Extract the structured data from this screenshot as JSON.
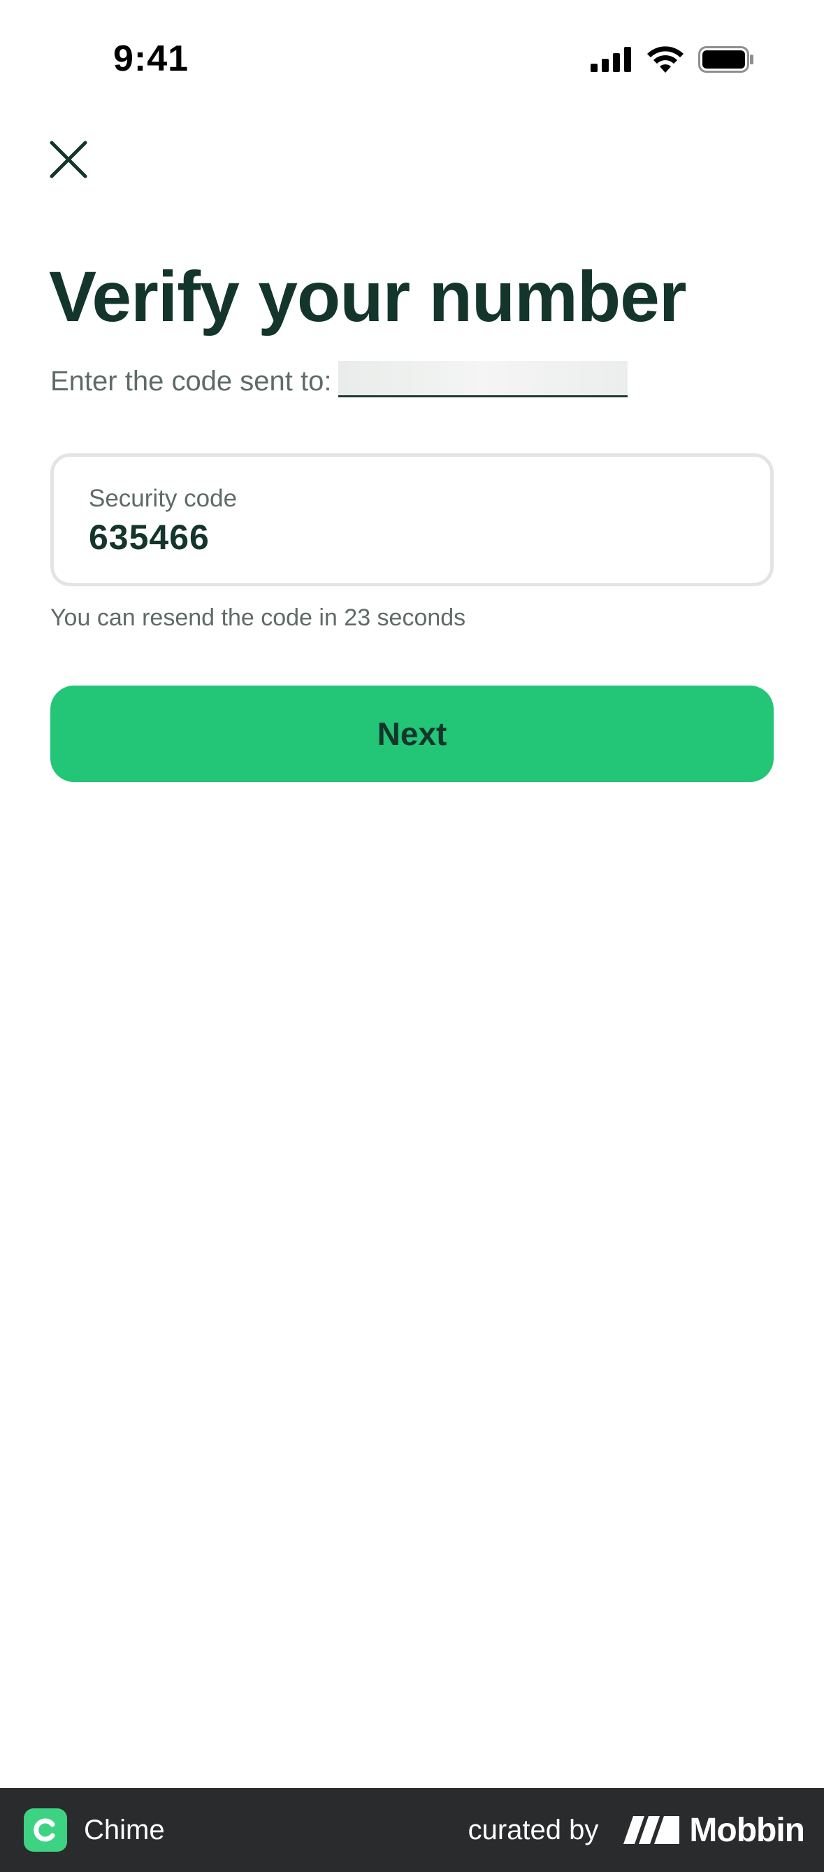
{
  "status_bar": {
    "time": "9:41",
    "icons": [
      "cellular-signal-icon",
      "wifi-icon",
      "battery-icon"
    ]
  },
  "header": {
    "close_icon": "close-icon"
  },
  "main": {
    "title": "Verify your number",
    "subtitle": "Enter the code sent to:",
    "code_field": {
      "label": "Security code",
      "value": "635466"
    },
    "resend_text": "You can resend the code in 23 seconds",
    "next_label": "Next"
  },
  "footer": {
    "app_name": "Chime",
    "curated_by": "curated by",
    "brand": "Mobbin"
  },
  "colors": {
    "primary": "#23c577",
    "text_dark": "#14352b",
    "text_muted": "#5f6b67",
    "footer_bg": "#2a2b2c"
  }
}
